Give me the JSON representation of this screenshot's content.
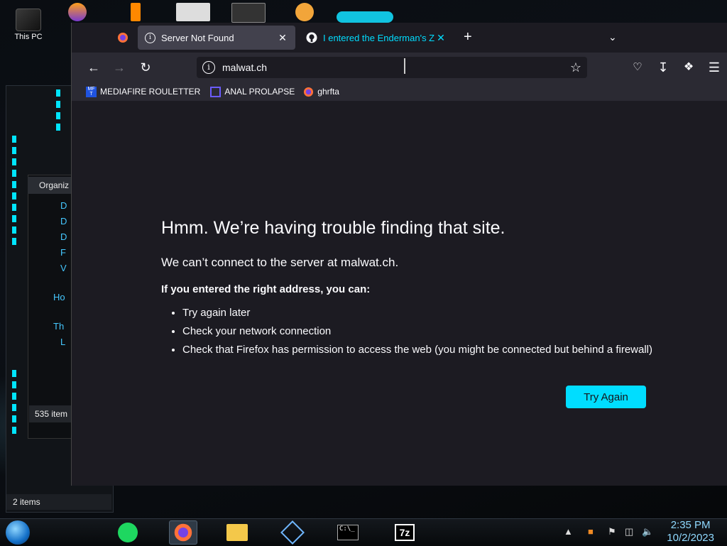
{
  "desktop": {
    "this_pc_label": "This PC"
  },
  "explorer": {
    "header": "Organiz",
    "items": [
      "D",
      "D",
      "D",
      "F",
      "V",
      "Ho",
      "Th",
      "L"
    ],
    "item_count": "535 item",
    "status": "2 items"
  },
  "browser": {
    "tabs": [
      {
        "label": "Server Not Found",
        "active": true
      },
      {
        "label": "I entered the Enderman's ZIP pa",
        "active": false
      }
    ],
    "new_tab_glyph": "+",
    "url": "malwat.ch",
    "bookmarks": [
      {
        "label": "MEDIAFIRE ROULETTER",
        "icon": "mediafire-icon"
      },
      {
        "label": "ANAL PROLAPSE",
        "icon": "sigma-icon"
      },
      {
        "label": "ghrfta",
        "icon": "firefox-icon"
      }
    ],
    "error": {
      "title": "Hmm. We’re having trouble finding that site.",
      "subtitle": "We can’t connect to the server at malwat.ch.",
      "lead": "If you entered the right address, you can:",
      "suggestions": [
        "Try again later",
        "Check your network connection",
        "Check that Firefox has permission to access the web (you might be connected but behind a firewall)"
      ],
      "button": "Try Again"
    },
    "colors": {
      "accent": "#00ddff",
      "page_bg": "#1c1b22",
      "toolbar_bg": "#2b2a33"
    }
  },
  "taskbar": {
    "time": "2:35 PM",
    "date": "10/2/2023",
    "apps": [
      "spotify-icon",
      "firefox-icon",
      "file-explorer-icon",
      "virtualbox-icon",
      "terminal-icon",
      "7zip-icon"
    ],
    "terminal_text": "C:\\_",
    "sevenzip_text": "7z"
  }
}
